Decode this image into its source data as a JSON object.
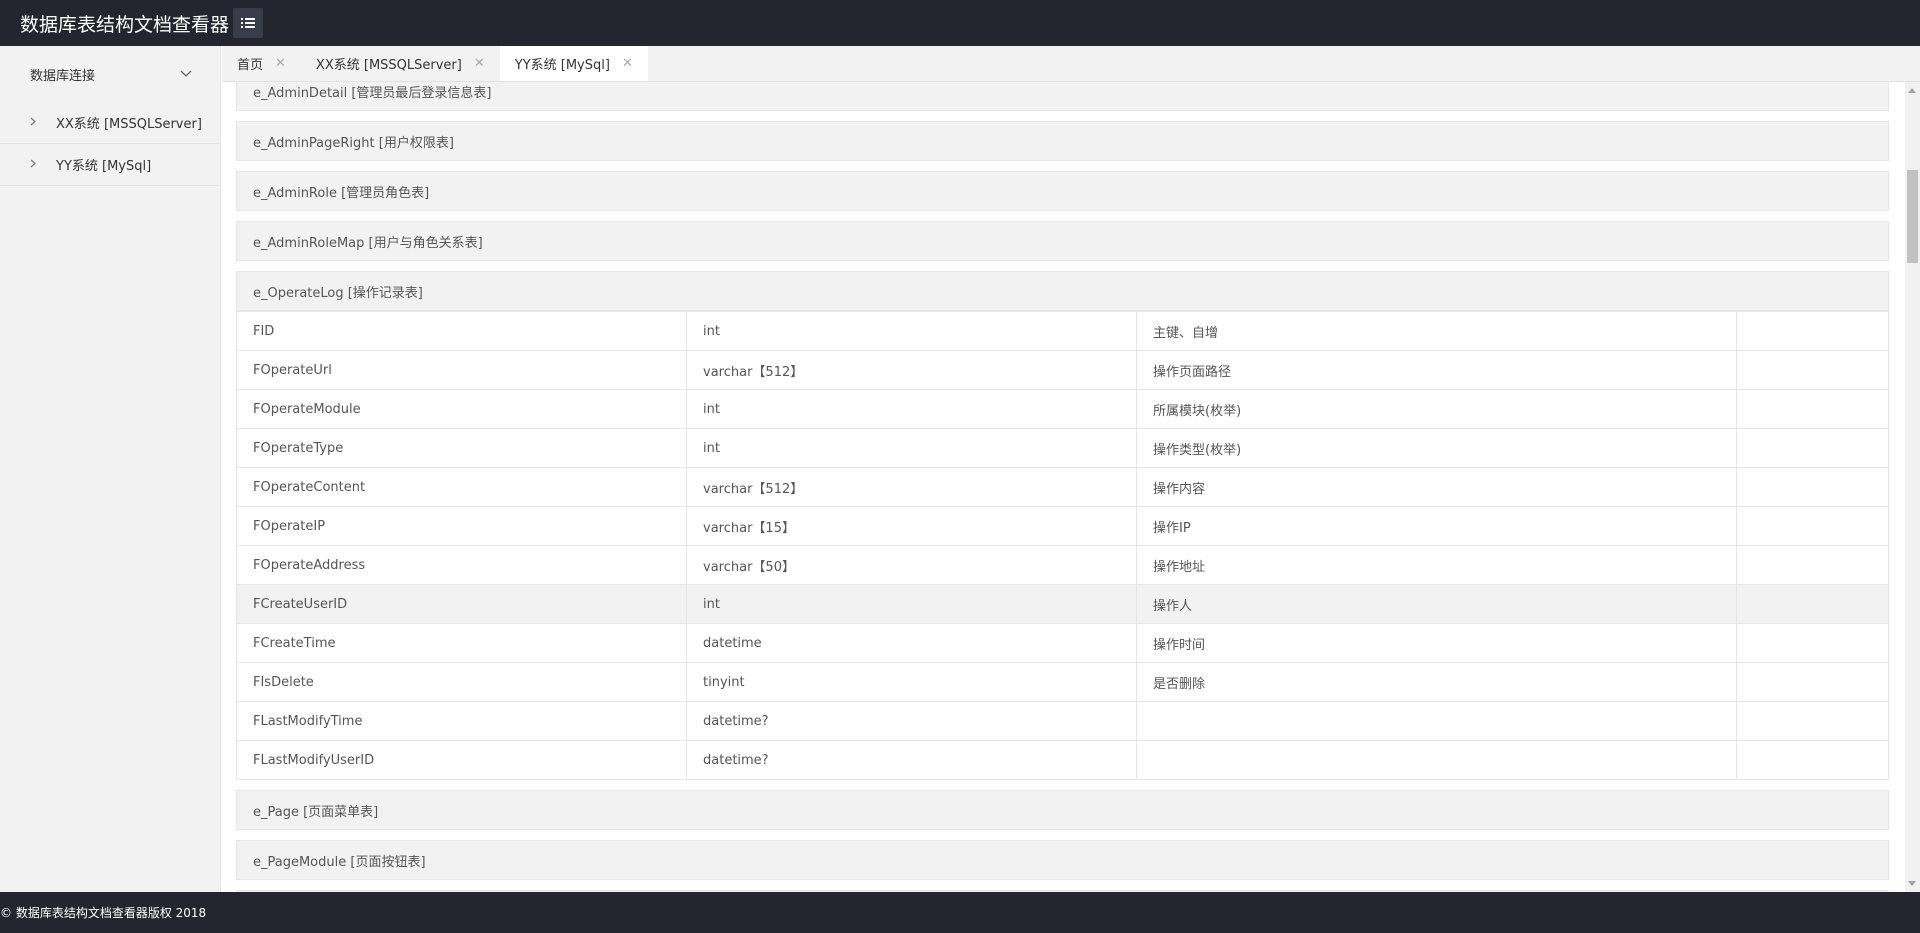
{
  "header": {
    "title": "数据库表结构文档查看器",
    "menu_icon": "list-icon"
  },
  "sidebar": {
    "group_label": "数据库连接",
    "items": [
      {
        "label": "XX系统 [MSSQLServer]"
      },
      {
        "label": "YY系统 [MySql]"
      }
    ]
  },
  "tabs": [
    {
      "label": "首页",
      "active": false
    },
    {
      "label": "XX系统 [MSSQLServer]",
      "active": false
    },
    {
      "label": "YY系统 [MySql]",
      "active": true
    }
  ],
  "tables": {
    "t0": "e_AdminDetail [管理员最后登录信息表]",
    "t1": "e_AdminPageRight [用户权限表]",
    "t2": "e_AdminRole [管理员角色表]",
    "t3": "e_AdminRoleMap [用户与角色关系表]",
    "t4": "e_OperateLog [操作记录表]",
    "t5": "e_Page [页面菜单表]",
    "t6": "e_PageModule [页面按钮表]"
  },
  "operate_log_columns": [
    {
      "name": "FID",
      "type": "int",
      "desc": "主键、自增",
      "extra": ""
    },
    {
      "name": "FOperateUrl",
      "type": "varchar【512】",
      "desc": "操作页面路径",
      "extra": ""
    },
    {
      "name": "FOperateModule",
      "type": "int",
      "desc": "所属模块(枚举)",
      "extra": ""
    },
    {
      "name": "FOperateType",
      "type": "int",
      "desc": "操作类型(枚举)",
      "extra": ""
    },
    {
      "name": "FOperateContent",
      "type": "varchar【512】",
      "desc": "操作内容",
      "extra": ""
    },
    {
      "name": "FOperateIP",
      "type": "varchar【15】",
      "desc": "操作IP",
      "extra": ""
    },
    {
      "name": "FOperateAddress",
      "type": "varchar【50】",
      "desc": "操作地址",
      "extra": ""
    },
    {
      "name": "FCreateUserID",
      "type": "int",
      "desc": "操作人",
      "extra": ""
    },
    {
      "name": "FCreateTime",
      "type": "datetime",
      "desc": "操作时间",
      "extra": ""
    },
    {
      "name": "FIsDelete",
      "type": "tinyint",
      "desc": "是否删除",
      "extra": ""
    },
    {
      "name": "FLastModifyTime",
      "type": "datetime?",
      "desc": "",
      "extra": ""
    },
    {
      "name": "FLastModifyUserID",
      "type": "datetime?",
      "desc": "",
      "extra": ""
    }
  ],
  "footer": {
    "text": "© 数据库表结构文档查看器版权 2018"
  },
  "colors": {
    "header_bg": "#23262e",
    "sidebar_bg": "#f2f2f2",
    "panel_bg": "#f2f2f2",
    "border": "#e6e6e6"
  }
}
